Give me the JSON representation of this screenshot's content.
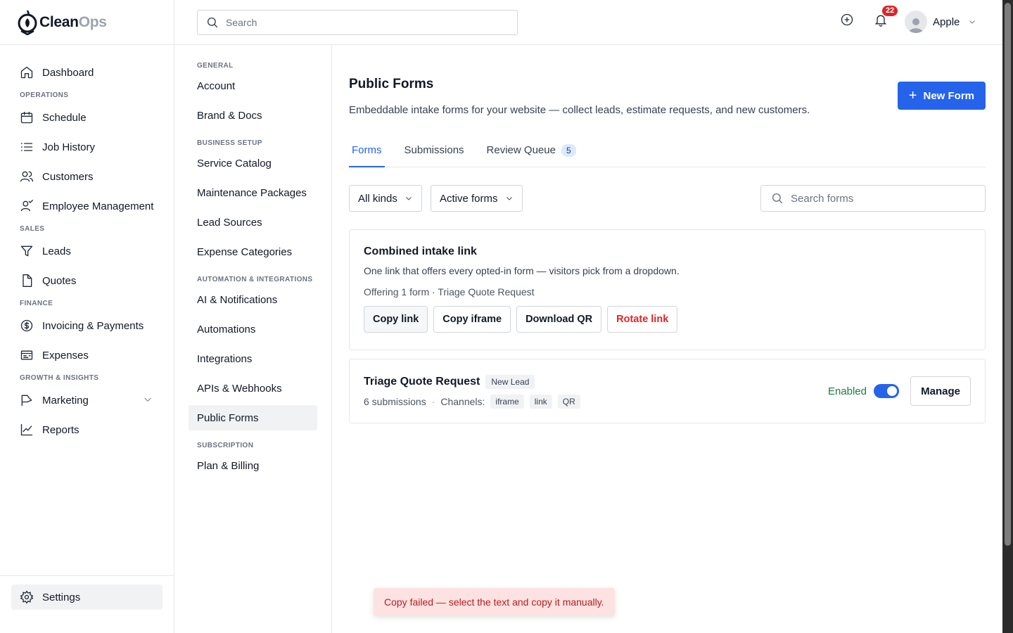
{
  "brand": {
    "name_part1": "Clean",
    "name_part2": "Ops"
  },
  "topbar": {
    "search_placeholder": "Search",
    "notifications_count": "22",
    "user_name": "Apple"
  },
  "sidebar": {
    "dashboard": "Dashboard",
    "section_operations": "OPERATIONS",
    "schedule": "Schedule",
    "job_history": "Job History",
    "customers": "Customers",
    "employee_management": "Employee Management",
    "section_sales": "SALES",
    "leads": "Leads",
    "quotes": "Quotes",
    "section_finance": "FINANCE",
    "invoicing": "Invoicing & Payments",
    "expenses": "Expenses",
    "section_growth": "GROWTH & INSIGHTS",
    "marketing": "Marketing",
    "reports": "Reports",
    "settings": "Settings"
  },
  "subnav": {
    "section_general": "GENERAL",
    "account": "Account",
    "brand_docs": "Brand & Docs",
    "section_business": "BUSINESS SETUP",
    "service_catalog": "Service Catalog",
    "maintenance_packages": "Maintenance Packages",
    "lead_sources": "Lead Sources",
    "expense_categories": "Expense Categories",
    "section_automation": "AUTOMATION & INTEGRATIONS",
    "ai_notifications": "AI & Notifications",
    "automations": "Automations",
    "integrations": "Integrations",
    "apis_webhooks": "APIs & Webhooks",
    "public_forms": "Public Forms",
    "section_subscription": "SUBSCRIPTION",
    "plan_billing": "Plan & Billing"
  },
  "main": {
    "title": "Public Forms",
    "description": "Embeddable intake forms for your website — collect leads, estimate requests, and new customers.",
    "new_form_label": "New Form",
    "tabs": {
      "forms": "Forms",
      "submissions": "Submissions",
      "review_queue": "Review Queue",
      "review_count": "5"
    },
    "filter_kind": "All kinds",
    "filter_status": "Active forms",
    "search_placeholder": "Search forms",
    "combined": {
      "title": "Combined intake link",
      "description": "One link that offers every opted-in form — visitors pick from a dropdown.",
      "offering": "Offering 1 form · Triage Quote Request",
      "copy_link": "Copy link",
      "copy_iframe": "Copy iframe",
      "download_qr": "Download QR",
      "rotate_link": "Rotate link"
    },
    "form": {
      "title": "Triage Quote Request",
      "tag": "New Lead",
      "submissions": "6 submissions",
      "separator": "·",
      "channels_label": "Channels:",
      "channels": [
        "iframe",
        "link",
        "QR"
      ],
      "enabled_label": "Enabled",
      "enabled": true,
      "manage": "Manage"
    }
  },
  "toast": {
    "message": "Copy failed — select the text and copy it manually."
  }
}
